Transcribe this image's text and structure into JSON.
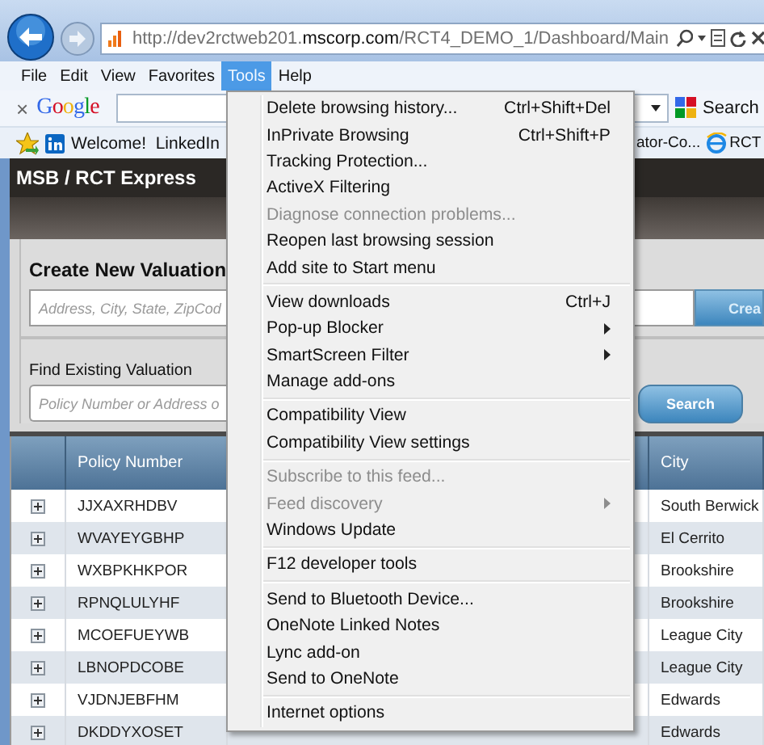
{
  "address_bar": {
    "url": "http://dev2rctweb201.**mscorp.com**/RCT4_DEMO_1/Dashboard/Main"
  },
  "menu_bar": {
    "items": [
      {
        "label": "File",
        "selected": false
      },
      {
        "label": "Edit",
        "selected": false
      },
      {
        "label": "View",
        "selected": false
      },
      {
        "label": "Favorites",
        "selected": false
      },
      {
        "label": "Tools",
        "selected": true
      },
      {
        "label": "Help",
        "selected": false
      }
    ]
  },
  "google_toolbar": {
    "close": "×",
    "logo": "Google",
    "search_button": "Search"
  },
  "favorites_bar": {
    "items": [
      {
        "kind": "linkedin",
        "label": "Welcome!  LinkedIn"
      },
      {
        "kind": "plain",
        "label": "ator-Co..."
      },
      {
        "kind": "ie",
        "label": "RCT"
      }
    ]
  },
  "page": {
    "title": "MSB / RCT Express",
    "create": {
      "heading": "Create New Valuation",
      "placeholder": "Address, City, State, ZipCod",
      "button": "Crea"
    },
    "find": {
      "heading": "Find Existing Valuation",
      "placeholder": "Policy Number or Address o",
      "button": "Search"
    },
    "table": {
      "columns": [
        "Policy Number",
        "City"
      ],
      "rows": [
        {
          "policy_number": "JJXAXRHDBV",
          "city": "South Berwick"
        },
        {
          "policy_number": "WVAYEYGBHP",
          "city": "El Cerrito"
        },
        {
          "policy_number": "WXBPKHKPOR",
          "city": "Brookshire"
        },
        {
          "policy_number": "RPNQLULYHF",
          "city": "Brookshire"
        },
        {
          "policy_number": "MCOEFUEYWB",
          "city": "League City"
        },
        {
          "policy_number": "LBNOPDCOBE",
          "city": "League City"
        },
        {
          "policy_number": "VJDNJEBFHM",
          "city": "Edwards"
        },
        {
          "policy_number": "DKDDYXOSET",
          "city": "Edwards"
        }
      ]
    }
  },
  "tools_menu": {
    "groups": [
      {
        "items": [
          {
            "label": "Delete browsing history...",
            "shortcut": "Ctrl+Shift+Del",
            "disabled": false,
            "has_submenu": false
          },
          {
            "label": "InPrivate Browsing",
            "shortcut": "Ctrl+Shift+P",
            "disabled": false,
            "has_submenu": false
          },
          {
            "label": "Tracking Protection...",
            "disabled": false,
            "has_submenu": false
          },
          {
            "label": "ActiveX Filtering",
            "disabled": false,
            "has_submenu": false
          },
          {
            "label": "Diagnose connection problems...",
            "disabled": true,
            "has_submenu": false
          },
          {
            "label": "Reopen last browsing session",
            "disabled": false,
            "has_submenu": false
          },
          {
            "label": "Add site to Start menu",
            "disabled": false,
            "has_submenu": false
          }
        ]
      },
      {
        "items": [
          {
            "label": "View downloads",
            "shortcut": "Ctrl+J",
            "disabled": false,
            "has_submenu": false
          },
          {
            "label": "Pop-up Blocker",
            "disabled": false,
            "has_submenu": true
          },
          {
            "label": "SmartScreen Filter",
            "disabled": false,
            "has_submenu": true
          },
          {
            "label": "Manage add-ons",
            "disabled": false,
            "has_submenu": false
          }
        ]
      },
      {
        "items": [
          {
            "label": "Compatibility View",
            "disabled": false,
            "has_submenu": false
          },
          {
            "label": "Compatibility View settings",
            "disabled": false,
            "has_submenu": false
          }
        ]
      },
      {
        "items": [
          {
            "label": "Subscribe to this feed...",
            "disabled": true,
            "has_submenu": false
          },
          {
            "label": "Feed discovery",
            "disabled": true,
            "has_submenu": true
          },
          {
            "label": "Windows Update",
            "disabled": false,
            "has_submenu": false
          }
        ]
      },
      {
        "items": [
          {
            "label": "F12 developer tools",
            "disabled": false,
            "has_submenu": false
          }
        ]
      },
      {
        "items": [
          {
            "label": "Send to Bluetooth Device...",
            "disabled": false,
            "has_submenu": false
          },
          {
            "label": "OneNote Linked Notes",
            "disabled": false,
            "has_submenu": false
          },
          {
            "label": "Lync add-on",
            "disabled": false,
            "has_submenu": false
          },
          {
            "label": "Send to OneNote",
            "disabled": false,
            "has_submenu": false
          }
        ]
      },
      {
        "items": [
          {
            "label": "Internet options",
            "disabled": false,
            "has_submenu": false
          }
        ]
      }
    ]
  }
}
